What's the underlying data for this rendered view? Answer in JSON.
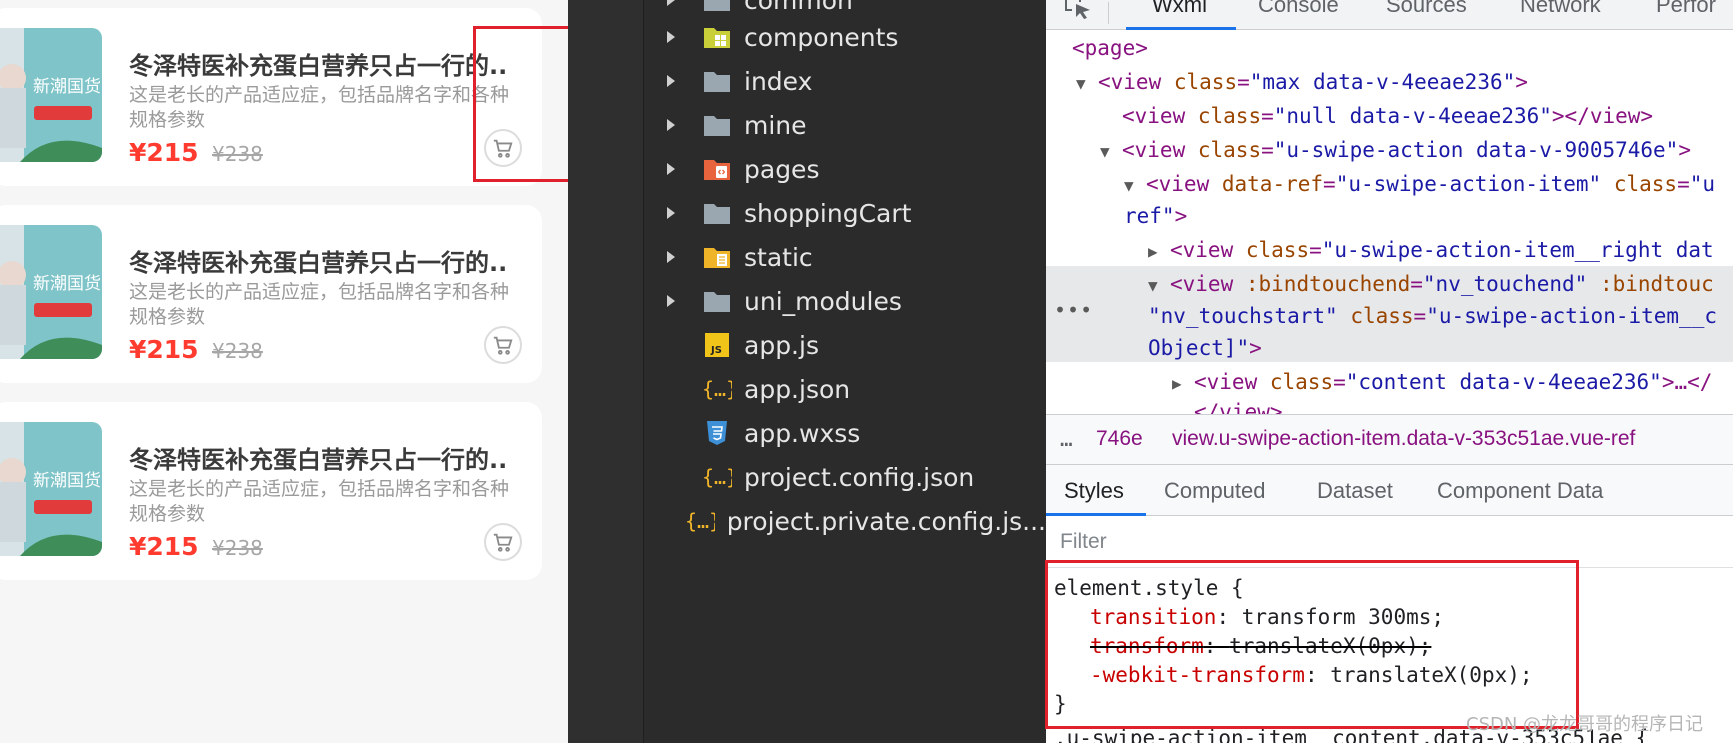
{
  "products": [
    {
      "title": "冬泽特医补充蛋白营养只占一行的...",
      "desc": "这是老长的产品适应症，包括品牌名字和各种规格参数",
      "price": "¥215",
      "old_price": "¥238",
      "thumb_text": "新潮国货"
    },
    {
      "title": "冬泽特医补充蛋白营养只占一行的...",
      "desc": "这是老长的产品适应症，包括品牌名字和各种规格参数",
      "price": "¥215",
      "old_price": "¥238",
      "thumb_text": "新潮国货"
    },
    {
      "title": "冬泽特医补充蛋白营养只占一行的...",
      "desc": "这是老长的产品适应症，包括品牌名字和各种规格参数",
      "price": "¥215",
      "old_price": "¥238",
      "thumb_text": "新潮国货"
    }
  ],
  "file_tree": [
    {
      "name": "common",
      "kind": "folder",
      "icon": "folder-icon"
    },
    {
      "name": "components",
      "kind": "folder",
      "icon": "components-folder-icon"
    },
    {
      "name": "index",
      "kind": "folder",
      "icon": "folder-icon"
    },
    {
      "name": "mine",
      "kind": "folder",
      "icon": "folder-icon"
    },
    {
      "name": "pages",
      "kind": "folder",
      "icon": "pages-folder-icon"
    },
    {
      "name": "shoppingCart",
      "kind": "folder",
      "icon": "folder-icon"
    },
    {
      "name": "static",
      "kind": "folder",
      "icon": "static-folder-icon"
    },
    {
      "name": "uni_modules",
      "kind": "folder",
      "icon": "folder-icon"
    },
    {
      "name": "app.js",
      "kind": "file",
      "icon": "js-file-icon"
    },
    {
      "name": "app.json",
      "kind": "file",
      "icon": "json-file-icon"
    },
    {
      "name": "app.wxss",
      "kind": "file",
      "icon": "css-file-icon"
    },
    {
      "name": "project.config.json",
      "kind": "file",
      "icon": "json-file-icon"
    },
    {
      "name": "project.private.config.js...",
      "kind": "file",
      "icon": "json-file-icon"
    }
  ],
  "devtools": {
    "tabs": [
      "Wxml",
      "Console",
      "Sources",
      "Network",
      "Perfor"
    ],
    "active_tab": "Wxml",
    "dom": {
      "l1_tag": "<page>",
      "l2_open": "<view",
      "l2_attr": "class",
      "l2_val": "\"max data-v-4eeae236\"",
      "l3_open": "<view",
      "l3_attr": "class",
      "l3_val": "\"null data-v-4eeae236\"",
      "l3_close": "></view>",
      "l4_open": "<view",
      "l4_attr": "class",
      "l4_val": "\"u-swipe-action data-v-9005746e\"",
      "l5_open": "<view",
      "l5_attr1": "data-ref",
      "l5_val1": "\"u-swipe-action-item\"",
      "l5_attr2": "class",
      "l5_val2": "\"u",
      "l5b_val": "ref\"",
      "l6_open": "<view",
      "l6_attr": "class",
      "l6_val": "\"u-swipe-action-item__right dat",
      "l7_open": "<view",
      "l7_attr1": ":bindtouchend",
      "l7_val1": "\"nv_touchend\"",
      "l7_attr2": ":bindtouc",
      "l7b_val": "\"nv_touchstart\"",
      "l7b_attr": "class",
      "l7b_val2": "\"u-swipe-action-item__c",
      "l7c_val": "Object]\"",
      "l8_open": "<view",
      "l8_attr": "class",
      "l8_val": "\"content data-v-4eeae236\"",
      "l8_close": ">…</",
      "l9_partial": "</view>"
    },
    "breadcrumb": {
      "ellipsis": "…",
      "partial": "746e",
      "selected": "view.u-swipe-action-item.data-v-353c51ae.vue-ref"
    },
    "sub_tabs": [
      "Styles",
      "Computed",
      "Dataset",
      "Component Data"
    ],
    "active_sub_tab": "Styles",
    "filter_placeholder": "Filter",
    "styles": {
      "selector": "element.style {",
      "rules": [
        {
          "prop": "transition",
          "value": "transform 300ms;",
          "struck": false
        },
        {
          "prop": "transform",
          "value": "translateX(0px);",
          "struck": true
        },
        {
          "prop": "-webkit-transform",
          "value": "translateX(0px);",
          "struck": false
        }
      ],
      "close": "}",
      "next_rule_partial": ".u-swipe-action-item__content.data-v-353c51ae {"
    }
  },
  "watermark": "CSDN @龙龙哥哥的程序日记",
  "colors": {
    "price_red": "#ff3b30",
    "highlight_red": "#e0202a",
    "tab_blue": "#1a73e8",
    "folder_gray": "#9aa7b1"
  }
}
